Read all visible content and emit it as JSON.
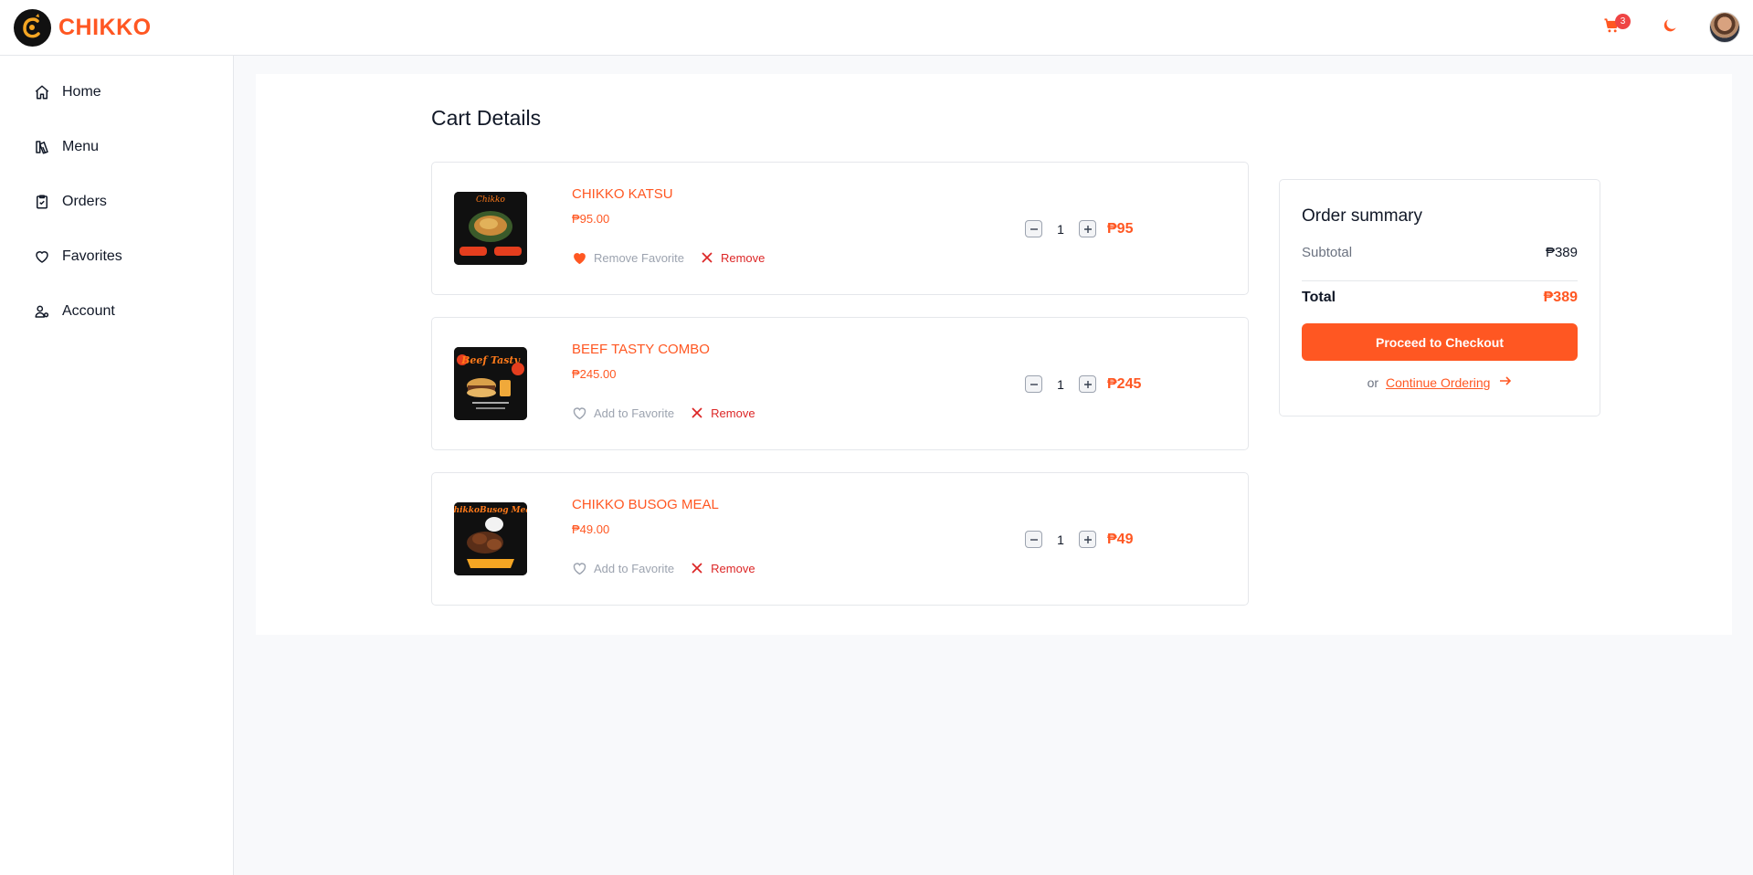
{
  "header": {
    "brand": "CHIKKO",
    "cart_count": "3"
  },
  "sidebar": {
    "items": [
      {
        "label": "Home",
        "icon": "home-icon"
      },
      {
        "label": "Menu",
        "icon": "menu-book-icon"
      },
      {
        "label": "Orders",
        "icon": "clipboard-icon"
      },
      {
        "label": "Favorites",
        "icon": "heart-icon"
      },
      {
        "label": "Account",
        "icon": "user-icon"
      }
    ]
  },
  "cart": {
    "title": "Cart Details",
    "items": [
      {
        "name": "CHIKKO KATSU",
        "price": "₱95.00",
        "favorite_label": "Remove Favorite",
        "is_favorite": true,
        "remove_label": "Remove",
        "quantity": "1",
        "total": "₱95"
      },
      {
        "name": "BEEF TASTY COMBO",
        "price": "₱245.00",
        "favorite_label": "Add to Favorite",
        "is_favorite": false,
        "remove_label": "Remove",
        "quantity": "1",
        "total": "₱245"
      },
      {
        "name": "CHIKKO BUSOG MEAL",
        "price": "₱49.00",
        "favorite_label": "Add to Favorite",
        "is_favorite": false,
        "remove_label": "Remove",
        "quantity": "1",
        "total": "₱49"
      }
    ]
  },
  "summary": {
    "title": "Order summary",
    "subtotal_label": "Subtotal",
    "subtotal_value": "₱389",
    "total_label": "Total",
    "total_value": "₱389",
    "checkout_label": "Proceed to Checkout",
    "or_label": "or",
    "continue_label": "Continue Ordering"
  },
  "colors": {
    "accent": "#ff5722",
    "danger": "#dc2626",
    "badge": "#ef4444"
  }
}
